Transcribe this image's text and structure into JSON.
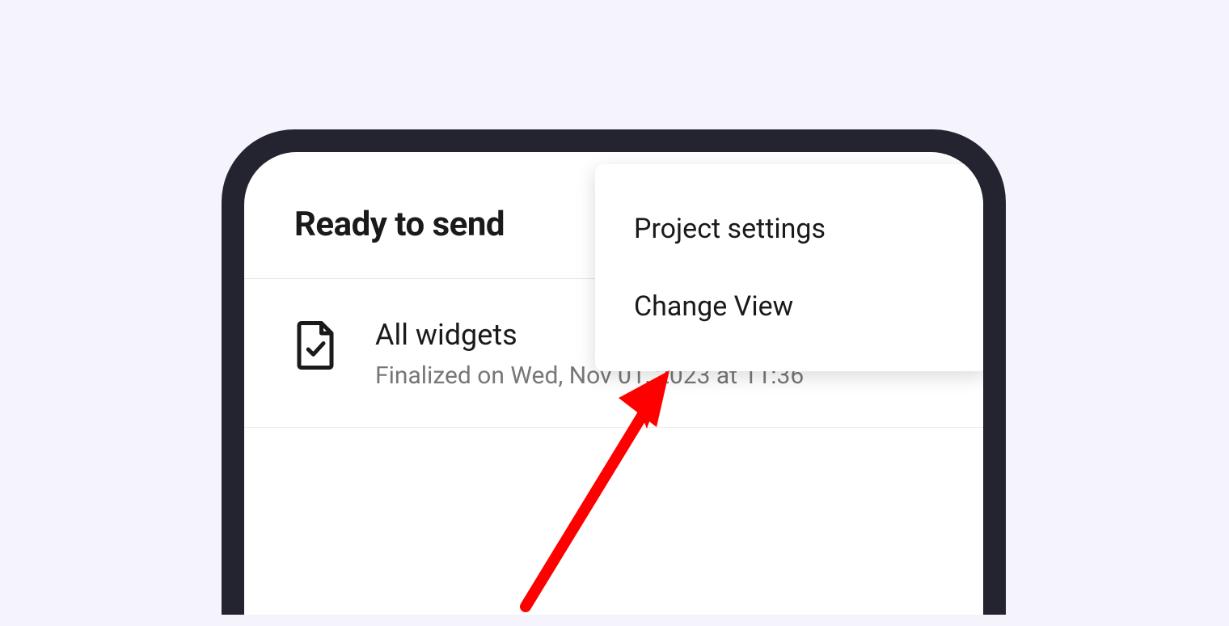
{
  "header": {
    "title": "Ready to send"
  },
  "list": {
    "items": [
      {
        "title": "All widgets",
        "subtitle": "Finalized on Wed, Nov 01, 2023 at 11:36"
      }
    ]
  },
  "menu": {
    "items": [
      {
        "label": "Project settings"
      },
      {
        "label": "Change View"
      }
    ]
  }
}
